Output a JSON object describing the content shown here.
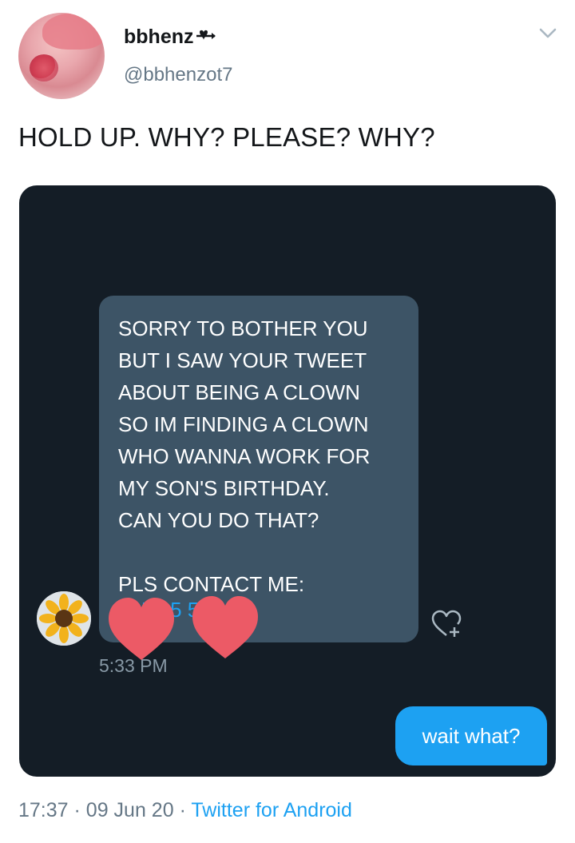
{
  "author": {
    "display_name": "bbhenz",
    "handle": "@bbhenzot7"
  },
  "tweet": {
    "text": "HOLD UP. WHY? PLEASE? WHY?"
  },
  "dm_screenshot": {
    "incoming_message": {
      "lines": [
        "SORRY TO BOTHER YOU",
        "BUT I SAW YOUR TWEET",
        "ABOUT BEING A CLOWN",
        "SO IM FINDING A CLOWN",
        "WHO WANNA WORK FOR",
        "MY SON'S BIRTHDAY.",
        "CAN YOU DO THAT?",
        "",
        "PLS CONTACT ME:"
      ],
      "contact_redacted": "085 25 52",
      "time": "5:33 PM"
    },
    "outgoing_message": {
      "text": "wait what?"
    }
  },
  "meta": {
    "time": "17:37",
    "separator": "·",
    "date": "09 Jun 20",
    "source": "Twitter for Android"
  },
  "icons": {
    "chevron": "chevron-down-icon",
    "reaction": "heart-add-icon"
  },
  "colors": {
    "link_blue": "#1da1f2",
    "dark_bg": "#141d26",
    "incoming_bubble": "#3d5466",
    "redaction_heart": "#ec5a66"
  }
}
